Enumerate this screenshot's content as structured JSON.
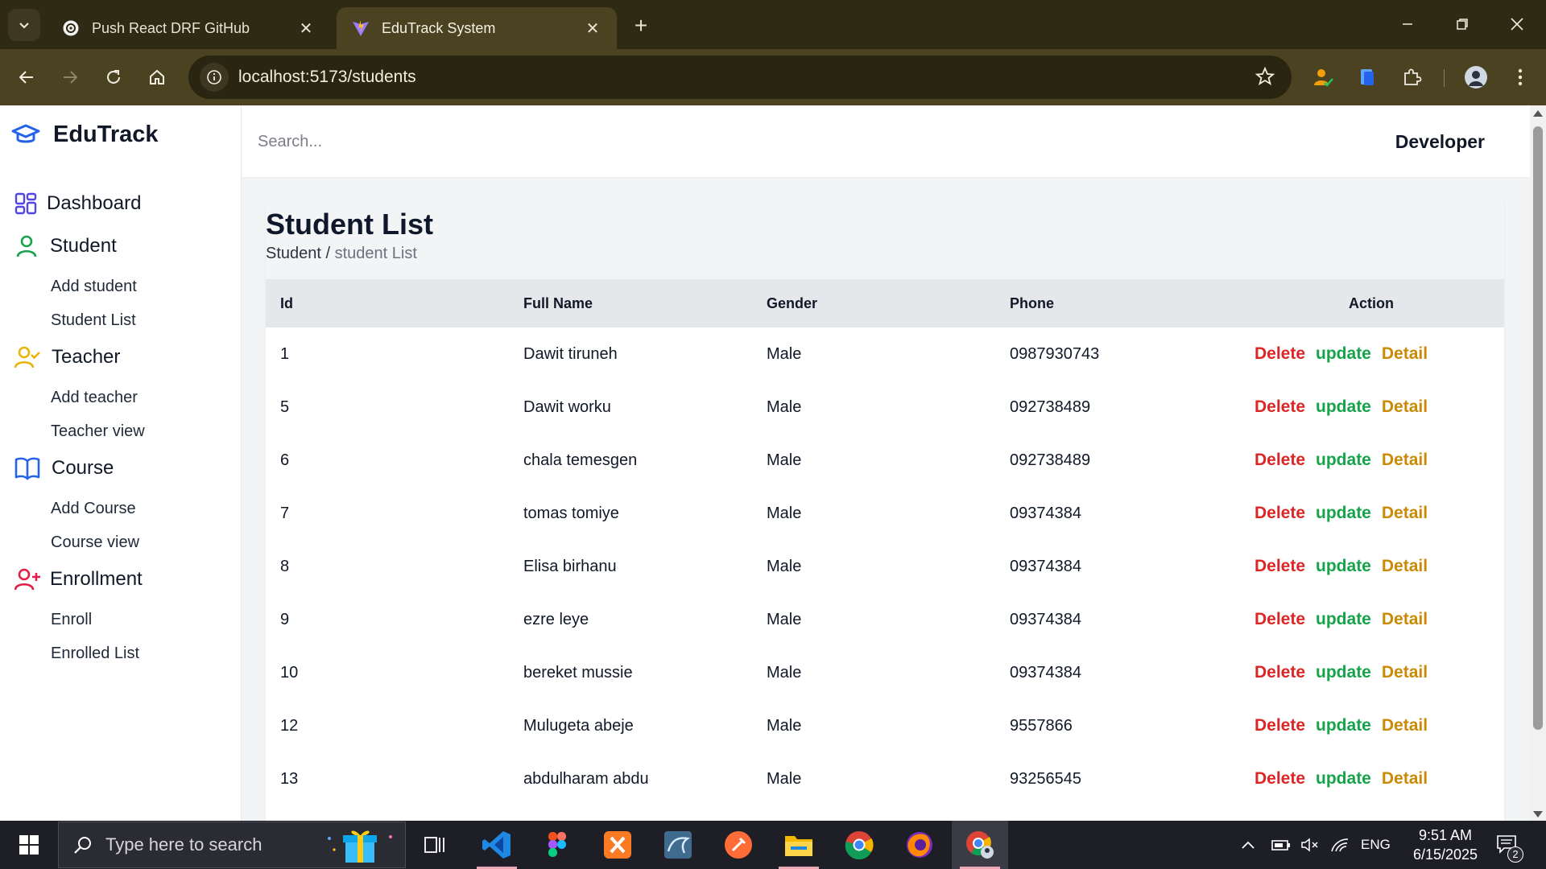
{
  "browser": {
    "tabs": [
      {
        "title": "Push React DRF GitHub",
        "favicon": "openai-icon",
        "active": false
      },
      {
        "title": "EduTrack System",
        "favicon": "vite-icon",
        "active": true
      }
    ],
    "url": "localhost:5173/students"
  },
  "app": {
    "brand": "EduTrack",
    "search_placeholder": "Search...",
    "user": "Developer",
    "nav": {
      "dashboard": "Dashboard",
      "student": {
        "label": "Student",
        "items": [
          "Add student",
          "Student List"
        ]
      },
      "teacher": {
        "label": "Teacher",
        "items": [
          "Add teacher",
          "Teacher view"
        ]
      },
      "course": {
        "label": "Course",
        "items": [
          "Add Course",
          "Course view"
        ]
      },
      "enrollment": {
        "label": "Enrollment",
        "items": [
          "Enroll",
          "Enrolled List"
        ]
      }
    },
    "colors": {
      "accent": "#2563eb",
      "student": "#16a34a",
      "teacher": "#eab308",
      "enrollment": "#e11d48",
      "delete": "#dc2626",
      "update": "#16a34a",
      "detail": "#ca8a04"
    }
  },
  "page": {
    "title": "Student List",
    "breadcrumb_parent": "Student",
    "breadcrumb_sep": " / ",
    "breadcrumb_current": "student List",
    "table": {
      "headers": [
        "Id",
        "Full Name",
        "Gender",
        "Phone",
        "Action"
      ],
      "actions": [
        "Delete",
        "update",
        "Detail"
      ],
      "rows": [
        {
          "id": "1",
          "name": "Dawit tiruneh",
          "gender": "Male",
          "phone": "0987930743"
        },
        {
          "id": "5",
          "name": "Dawit worku",
          "gender": "Male",
          "phone": "092738489"
        },
        {
          "id": "6",
          "name": "chala temesgen",
          "gender": "Male",
          "phone": "092738489"
        },
        {
          "id": "7",
          "name": "tomas tomiye",
          "gender": "Male",
          "phone": "09374384"
        },
        {
          "id": "8",
          "name": "Elisa birhanu",
          "gender": "Male",
          "phone": "09374384"
        },
        {
          "id": "9",
          "name": "ezre leye",
          "gender": "Male",
          "phone": "09374384"
        },
        {
          "id": "10",
          "name": "bereket mussie",
          "gender": "Male",
          "phone": "09374384"
        },
        {
          "id": "12",
          "name": "Mulugeta abeje",
          "gender": "Male",
          "phone": "9557866"
        },
        {
          "id": "13",
          "name": "abdulharam abdu",
          "gender": "Male",
          "phone": "93256545"
        }
      ]
    }
  },
  "taskbar": {
    "search_placeholder": "Type here to search",
    "language": "ENG",
    "time": "9:51 AM",
    "date": "6/15/2025",
    "notifications": "2"
  }
}
